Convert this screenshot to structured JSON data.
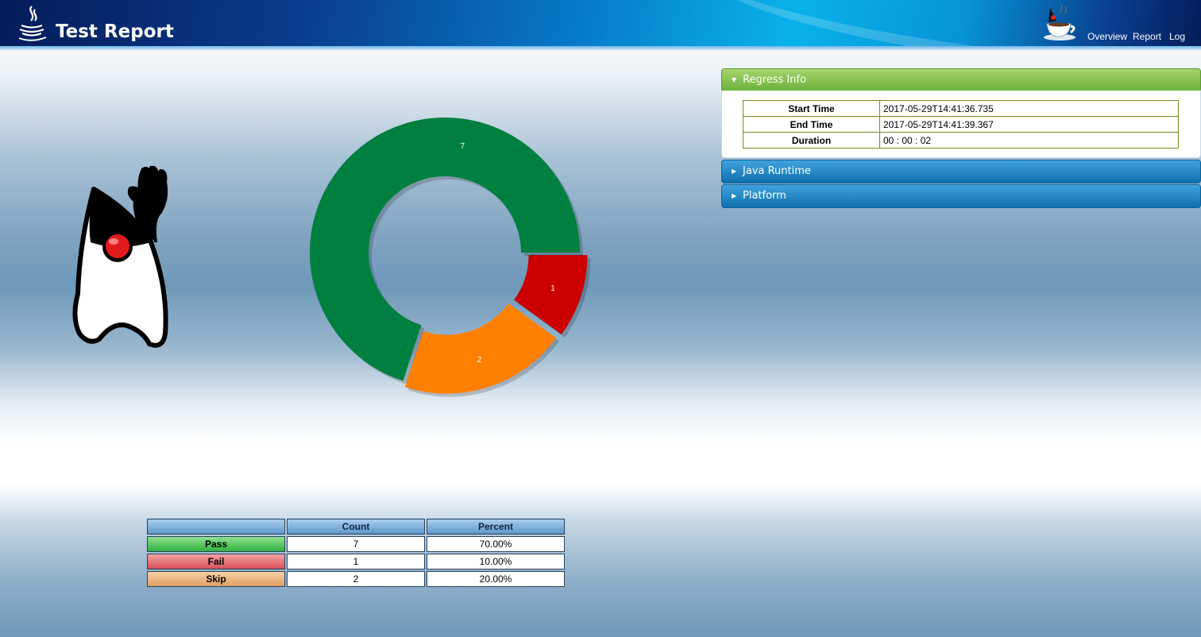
{
  "header": {
    "title": "Test Report",
    "nav": [
      "Overview",
      "Report",
      "Log"
    ]
  },
  "chart_data": {
    "type": "pie",
    "style": "donut",
    "categories": [
      "Pass",
      "Fail",
      "Skip"
    ],
    "values": [
      7,
      1,
      2
    ],
    "colors": [
      "#008040",
      "#cc0000",
      "#ff8000"
    ]
  },
  "summary": {
    "headers": [
      "",
      "Count",
      "Percent"
    ],
    "rows": [
      {
        "label": "Pass",
        "count": "7",
        "percent": "70.00%"
      },
      {
        "label": "Fail",
        "count": "1",
        "percent": "10.00%"
      },
      {
        "label": "Skip",
        "count": "2",
        "percent": "20.00%"
      }
    ]
  },
  "accordion": {
    "regress": {
      "title": "Regress Info",
      "rows": [
        {
          "key": "Start Time",
          "value": "2017-05-29T14:41:36.735"
        },
        {
          "key": "End Time",
          "value": "2017-05-29T14:41:39.367"
        },
        {
          "key": "Duration",
          "value": "00 : 00 : 02"
        }
      ]
    },
    "java_runtime": {
      "title": "Java Runtime"
    },
    "platform": {
      "title": "Platform"
    }
  },
  "icons": {
    "logo": "java-logo-icon",
    "cup": "coffee-cup-icon",
    "mascot": "duke-mascot-icon",
    "expanded": "triangle-down-icon",
    "collapsed": "triangle-right-icon"
  }
}
